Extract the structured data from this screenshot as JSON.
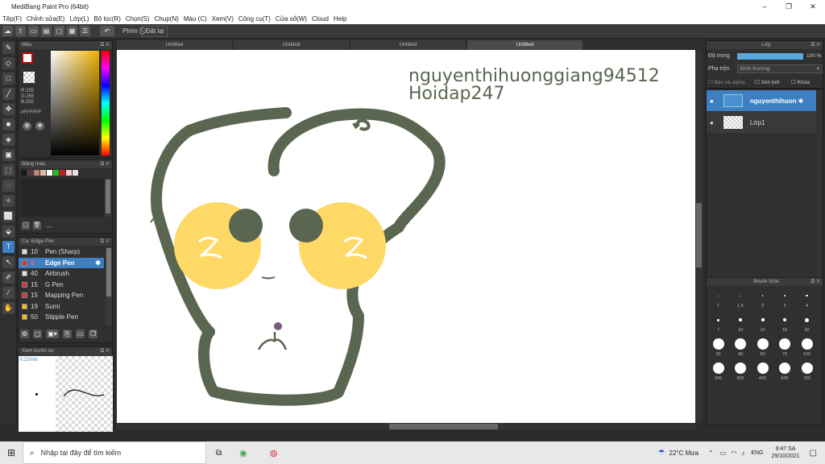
{
  "window": {
    "title": "MediBang Paint Pro (64bit)",
    "minimize": "–",
    "maximize": "❐",
    "close": "✕"
  },
  "menu": [
    "Tệp(F)",
    "Chỉnh sửa(E)",
    "Lớp(L)",
    "Bộ lọc(R)",
    "Chọn(S)",
    "Chụp(N)",
    "Màu (C)",
    "Xem(V)",
    "Công cụ(T)",
    "Cửa sổ(W)",
    "Cloud",
    "Help"
  ],
  "toolbar": {
    "shortcut_label": "Phím",
    "reset_label": "Đặt lại"
  },
  "color_panel": {
    "title": "Màu",
    "r": "R:255",
    "g": "G:255",
    "b": "B:255",
    "hex": "#FFFFFF"
  },
  "palette_panel": {
    "title": "Bảng màu",
    "dash": "---",
    "swatches": [
      "#1a1a1a",
      "#5a3a3a",
      "#c08080",
      "#e0c0a0",
      "#ffffff",
      "#20c020",
      "#c02020",
      "#f0d0d0",
      "#f0e0e0"
    ]
  },
  "brush_panel": {
    "title": "Cọ: Edge Pen",
    "brushes": [
      {
        "size": "10",
        "name": "Pen (Sharp)",
        "color": "#e0e0e0"
      },
      {
        "size": "5",
        "name": "Edge Pen",
        "color": "#e03030",
        "selected": true
      },
      {
        "size": "40",
        "name": "Airbrush",
        "color": "#e0e0e0"
      },
      {
        "size": "15",
        "name": "G Pen",
        "color": "#e03030"
      },
      {
        "size": "15",
        "name": "Mapping Pen",
        "color": "#e03030"
      },
      {
        "size": "19",
        "name": "Sumi",
        "color": "#f0c020"
      },
      {
        "size": "50",
        "name": "Stipple Pen",
        "color": "#f0c020"
      },
      {
        "size": "2",
        "name": "Pen",
        "color": "#e0e0e0"
      }
    ]
  },
  "preview_panel": {
    "title": "Xem trước cọ",
    "size": "0.22mm"
  },
  "tabs": [
    "Untitled",
    "Untitled",
    "Untitled",
    "Untitled"
  ],
  "canvas": {
    "text_line1": "nguyenthihuonggiang94512",
    "text_line2": "Hoidap247"
  },
  "layer_panel": {
    "title": "Lớp",
    "opacity_label": "Độ trong",
    "opacity_value": "100 %",
    "opacity_fraction": 1.0,
    "blend_label": "Pha trộn",
    "blend_value": "Bình thường",
    "protect_alpha": "Bảo vệ alpha",
    "clip": "Xén bớt",
    "lock": "Khóa",
    "layers": [
      {
        "name": "nguyenthihuon",
        "selected": true
      },
      {
        "name": "Lớp1",
        "selected": false
      }
    ]
  },
  "brush_size_panel": {
    "title": "Brush Size",
    "sizes": [
      "1",
      "1.5",
      "2",
      "3",
      "4",
      "7",
      "10",
      "12",
      "15",
      "20",
      "30",
      "40",
      "50",
      "70",
      "100",
      "200",
      "300",
      "400",
      "500",
      "700"
    ]
  },
  "taskbar": {
    "search_placeholder": "Nhập tại đây để tìm kiếm",
    "weather": "22°C  Mưa",
    "lang": "ENG",
    "time": "9:47 SA",
    "date": "29/10/2021"
  },
  "colors": {
    "accent": "#3d7fc1",
    "skull_outline": "#5a6650",
    "cheek": "#ffd966",
    "text_green": "#5a6650"
  }
}
